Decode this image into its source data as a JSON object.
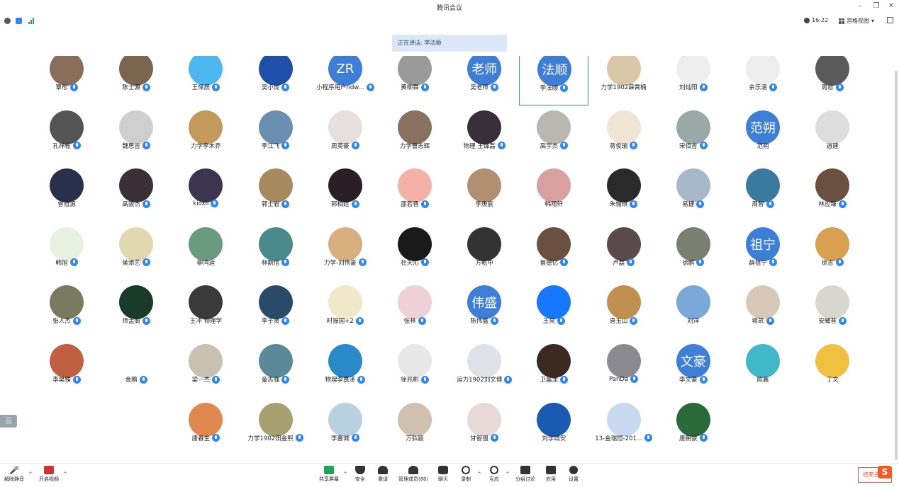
{
  "window": {
    "title": "腾讯会议",
    "minimize": "–",
    "restore": "❐",
    "close": "✕"
  },
  "status": {
    "time": "16:22",
    "view_label": "宫格视图",
    "info_icon": "info-icon",
    "shield_icon": "shield-icon",
    "signal_icon": "signal-icon"
  },
  "speaking": {
    "text": "正在讲话: 李法顺"
  },
  "colors": {
    "accent_blue": "#2f86f5",
    "active_border": "#21b35b",
    "end_red": "#e25c4a"
  },
  "participants": [
    {
      "name": "覃彤",
      "text": "",
      "bg": "#8a6d5a",
      "mic": true
    },
    {
      "name": "陈士源",
      "text": "",
      "bg": "#7a6650",
      "mic": true
    },
    {
      "name": "王怿辰",
      "text": "",
      "bg": "#4db8f0",
      "mic": true
    },
    {
      "name": "吴小虎",
      "text": "",
      "bg": "#1f4fa8",
      "mic": true
    },
    {
      "name": "小程序用户ndw...",
      "text": "ZR",
      "bg": "#3d7ed8",
      "mic": true
    },
    {
      "name": "黄柳霖",
      "text": "",
      "bg": "#9a9a9a",
      "mic": true
    },
    {
      "name": "吴老师",
      "text": "老师",
      "bg": "#3d7ed8",
      "mic": true
    },
    {
      "name": "李法顺",
      "text": "法顺",
      "bg": "#3d7ed8",
      "mic": true,
      "active": true
    },
    {
      "name": "力学1902薛霄楠",
      "text": "",
      "bg": "#d9c7a8",
      "mic": false
    },
    {
      "name": "刘灿阳",
      "text": "",
      "bg": "#eeeeee",
      "mic": true
    },
    {
      "name": "余乐涵",
      "text": "",
      "bg": "#eeeeee",
      "mic": true
    },
    {
      "name": "周愈",
      "text": "",
      "bg": "#5a5a5a",
      "mic": true
    },
    {
      "name": "孔祥栋",
      "text": "",
      "bg": "#555555",
      "mic": true
    },
    {
      "name": "魏思吉",
      "text": "",
      "bg": "#cfcfcf",
      "mic": true
    },
    {
      "name": "力学李木乔",
      "text": "",
      "bg": "#c49a5c",
      "mic": false
    },
    {
      "name": "李江飞",
      "text": "",
      "bg": "#6a8fb0",
      "mic": true
    },
    {
      "name": "周英豪",
      "text": "",
      "bg": "#e8e0e0",
      "mic": true
    },
    {
      "name": "力学曹志辉",
      "text": "",
      "bg": "#8a7060",
      "mic": false
    },
    {
      "name": "物理 王锋磊",
      "text": "",
      "bg": "#3a2e3a",
      "mic": true
    },
    {
      "name": "高宇杰",
      "text": "",
      "bg": "#b8b8b0",
      "mic": true
    },
    {
      "name": "蒋俊瑜",
      "text": "",
      "bg": "#f0e6d8",
      "mic": true
    },
    {
      "name": "宋佰吉",
      "text": "",
      "bg": "#9aa8a8",
      "mic": true
    },
    {
      "name": "范朔",
      "text": "范朔",
      "bg": "#3d7ed8",
      "mic": false
    },
    {
      "name": "逍建",
      "text": "",
      "bg": "#dddddd",
      "mic": false
    },
    {
      "name": "曾冠源",
      "text": "",
      "bg": "#2a2f4a",
      "mic": false
    },
    {
      "name": "高骏杰",
      "text": "",
      "bg": "#3a3036",
      "mic": true
    },
    {
      "name": "kioxli",
      "text": "",
      "bg": "#3d3550",
      "mic": true
    },
    {
      "name": "郭士岩",
      "text": "",
      "bg": "#a88a60",
      "mic": true
    },
    {
      "name": "郭相廷",
      "text": "",
      "bg": "#2a1f25",
      "mic": true
    },
    {
      "name": "邵若晋",
      "text": "",
      "bg": "#f5b0a8",
      "mic": true
    },
    {
      "name": "李庚宸",
      "text": "",
      "bg": "#b09070",
      "mic": false
    },
    {
      "name": "韩雨轩",
      "text": "",
      "bg": "#d8a0a0",
      "mic": false
    },
    {
      "name": "朱愉琪",
      "text": "",
      "bg": "#2a2a2a",
      "mic": true
    },
    {
      "name": "易捷",
      "text": "",
      "bg": "#a8b8c8",
      "mic": true
    },
    {
      "name": "周智",
      "text": "",
      "bg": "#3a7aa0",
      "mic": true
    },
    {
      "name": "林应臻",
      "text": "",
      "bg": "#6a5040",
      "mic": true
    },
    {
      "name": "韩旭",
      "text": "",
      "bg": "#e8f0e0",
      "mic": true
    },
    {
      "name": "侯添艺",
      "text": "",
      "bg": "#e0d8b0",
      "mic": true
    },
    {
      "name": "柳鸿运",
      "text": "",
      "bg": "#6a9a80",
      "mic": false
    },
    {
      "name": "林斯信",
      "text": "",
      "bg": "#4a8a8a",
      "mic": true
    },
    {
      "name": "力学-刘伟豪",
      "text": "",
      "bg": "#d8b080",
      "mic": true
    },
    {
      "name": "杜天沁",
      "text": "",
      "bg": "#1a1a1a",
      "mic": true
    },
    {
      "name": "方乾中",
      "text": "",
      "bg": "#333333",
      "mic": false
    },
    {
      "name": "蔡德亿",
      "text": "",
      "bg": "#6a5040",
      "mic": true
    },
    {
      "name": "卢磊",
      "text": "",
      "bg": "#5a4a4a",
      "mic": true
    },
    {
      "name": "徐鹏",
      "text": "",
      "bg": "#7a8070",
      "mic": true
    },
    {
      "name": "薛祖宁",
      "text": "祖宁",
      "bg": "#3d7ed8",
      "mic": true
    },
    {
      "name": "徐吉",
      "text": "",
      "bg": "#d8a050",
      "mic": true
    },
    {
      "name": "张人杰",
      "text": "",
      "bg": "#7a7a60",
      "mic": true
    },
    {
      "name": "师孟阁",
      "text": "",
      "bg": "#1a3a2a",
      "mic": true
    },
    {
      "name": "王冲 物理学",
      "text": "",
      "bg": "#3a3a3a",
      "mic": false
    },
    {
      "name": "李子贤",
      "text": "",
      "bg": "#2a4a6a",
      "mic": true
    },
    {
      "name": "时振国+2",
      "text": "",
      "bg": "#f0e8c8",
      "mic": true
    },
    {
      "name": "张林",
      "text": "",
      "bg": "#f0d0d8",
      "mic": true
    },
    {
      "name": "陈伟盛",
      "text": "伟盛",
      "bg": "#3d7ed8",
      "mic": true
    },
    {
      "name": "王亮",
      "text": "",
      "bg": "#1677ff",
      "mic": true
    },
    {
      "name": "唐玉山",
      "text": "",
      "bg": "#c09050",
      "mic": true
    },
    {
      "name": "刘洋",
      "text": "",
      "bg": "#7aa8d8",
      "mic": false
    },
    {
      "name": "蒋凯",
      "text": "",
      "bg": "#d8c8b8",
      "mic": true
    },
    {
      "name": "安耀普",
      "text": "",
      "bg": "#d8d8d0",
      "mic": true
    },
    {
      "name": "李昊臻",
      "text": "",
      "bg": "#c06040",
      "mic": true
    },
    {
      "name": "金鹏",
      "text": "",
      "bg": "#ffffff",
      "mic": true
    },
    {
      "name": "梁一杰",
      "text": "",
      "bg": "#c8c0b0",
      "mic": true
    },
    {
      "name": "童志强",
      "text": "",
      "bg": "#5a8a9a",
      "mic": true
    },
    {
      "name": "物理李嘉泽",
      "text": "",
      "bg": "#2a8ac8",
      "mic": true
    },
    {
      "name": "徐兆彬",
      "text": "",
      "bg": "#e8e8e8",
      "mic": true
    },
    {
      "name": "运力1902刘文博",
      "text": "",
      "bg": "#e0e0e8",
      "mic": true
    },
    {
      "name": "卫晨龙",
      "text": "",
      "bg": "#3a2a20",
      "mic": true
    },
    {
      "name": "PanDa",
      "text": "",
      "bg": "#8a8a90",
      "mic": true
    },
    {
      "name": "李文豪",
      "text": "文豪",
      "bg": "#3d7ed8",
      "mic": true
    },
    {
      "name": "陈鑫",
      "text": "",
      "bg": "#40b8c8",
      "mic": false
    },
    {
      "name": "丁文",
      "text": "",
      "bg": "#f0c040",
      "mic": false
    },
    {
      "name": "唐春生",
      "text": "",
      "bg": "#e08850",
      "mic": true
    },
    {
      "name": "力学1902田金熙",
      "text": "",
      "bg": "#a8a070",
      "mic": true
    },
    {
      "name": "李嘉诚",
      "text": "",
      "bg": "#b8d0e0",
      "mic": true
    },
    {
      "name": "万弘毅",
      "text": "",
      "bg": "#d0c0b0",
      "mic": false
    },
    {
      "name": "甘智强",
      "text": "",
      "bg": "#e8d8d8",
      "mic": true
    },
    {
      "name": "刘李靖安",
      "text": "",
      "bg": "#1a5ab0",
      "mic": false
    },
    {
      "name": "13-金瑞恒-201...",
      "text": "",
      "bg": "#c8d8f0",
      "mic": true
    },
    {
      "name": "唐朝骏",
      "text": "",
      "bg": "#2a6a3a",
      "mic": true
    }
  ],
  "toolbar": {
    "unmute": "解除静音",
    "start_video": "开启视频",
    "share_screen": "共享屏幕",
    "security": "安全",
    "invite": "邀请",
    "members": "管理成员(80)",
    "chat": "聊天",
    "record": "录制",
    "reactions": "互应",
    "breakout": "分组讨论",
    "apps": "应用",
    "settings": "设置",
    "end": "结束会"
  }
}
